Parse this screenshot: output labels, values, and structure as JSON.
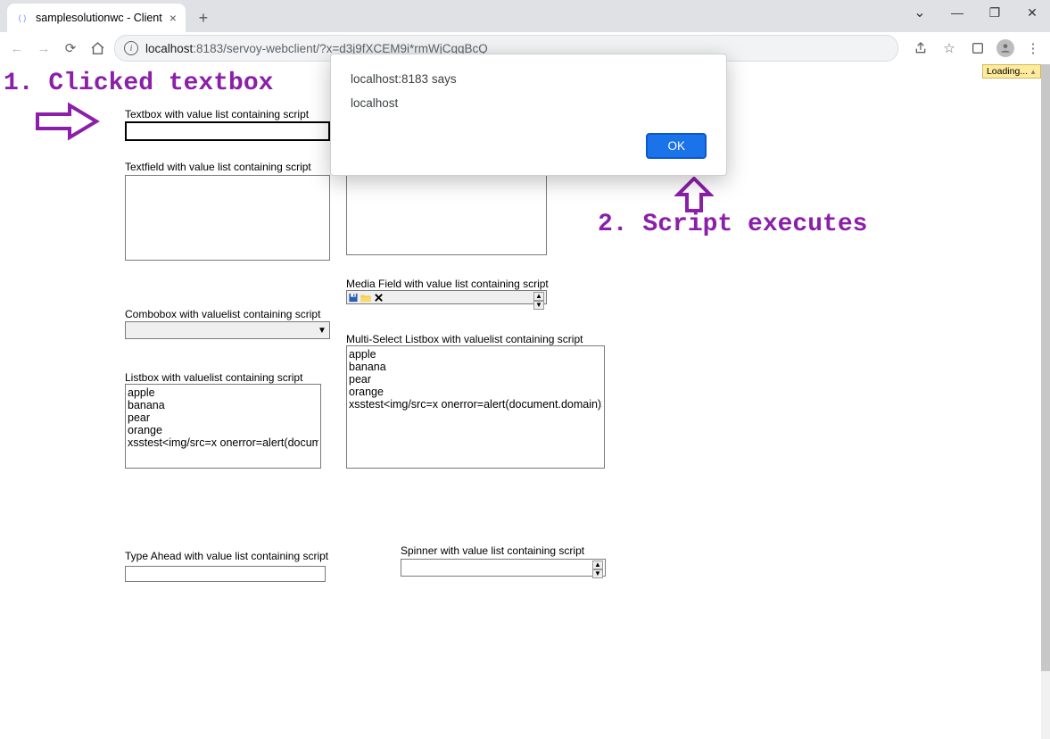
{
  "browser": {
    "tab_title": "samplesolutionwc - Client",
    "url_host": "localhost",
    "url_port_path": ":8183/servoy-webclient/?x=d3j9fXCEM9i*rmWjCqqBcQ",
    "loading_label": "Loading..."
  },
  "dialog": {
    "title": "localhost:8183 says",
    "message": "localhost",
    "ok_label": "OK"
  },
  "annotations": {
    "step1": "1. Clicked textbox",
    "step2": "2. Script executes"
  },
  "form": {
    "textbox_label": "Textbox with value list containing script",
    "textbox_value": "",
    "textfield_label": "Textfield with value list containing script",
    "media_label": "Media Field with value list containing script",
    "combobox_label": "Combobox with valuelist containing script",
    "combobox_value": "",
    "multiselect_label": "Multi-Select Listbox with valuelist containing script",
    "listbox_label": "Listbox with valuelist containing script",
    "typeahead_label": "Type Ahead with value list containing script",
    "typeahead_value": "",
    "spinner_label": "Spinner with value list containing script",
    "spinner_value": "",
    "listbox_items": [
      "apple",
      "banana",
      "pear",
      "orange",
      "xsstest<img/src=x onerror=alert(documen"
    ],
    "multiselect_items": [
      "apple",
      "banana",
      "pear",
      "orange",
      "xsstest<img/src=x onerror=alert(document.domain)>"
    ]
  }
}
